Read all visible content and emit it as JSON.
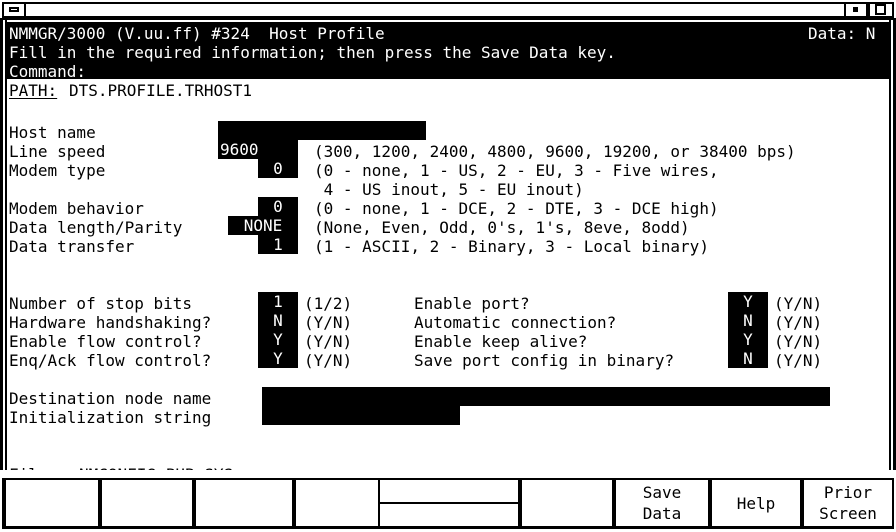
{
  "window": {
    "title": "",
    "left_button_icon": "minimize-icon",
    "min_button_icon": "restore-icon",
    "max_button_icon": "maximize-icon"
  },
  "header": {
    "app_title": "NMMGR/3000 (V.uu.ff) #324  Host Profile",
    "data_status_label": "Data: N",
    "instruction": "Fill in the required information; then press the Save Data key.",
    "command_label": "Command:",
    "command_value": ""
  },
  "path": {
    "label": "PATH:",
    "value": "DTS.PROFILE.TRHOST1"
  },
  "form": {
    "rows": [
      {
        "label": "Host name",
        "value": "",
        "field_chars": 20,
        "help": ""
      },
      {
        "label": "Line speed",
        "value": "9600",
        "field_chars": 6,
        "help": "(300, 1200, 2400, 4800, 9600, 19200, or 38400 bps)"
      },
      {
        "label": "Modem type",
        "value": "0",
        "field_chars": 1,
        "help": "(0 - none, 1 - US, 2 - EU, 3 - Five wires,"
      },
      {
        "label": "",
        "value": null,
        "field_chars": 0,
        "help": " 4 - US inout, 5 - EU inout)"
      },
      {
        "label": "Modem behavior",
        "value": "0",
        "field_chars": 1,
        "help": "(0 - none, 1 - DCE, 2 - DTE, 3 - DCE high)"
      },
      {
        "label": "Data length/Parity",
        "value": "NONE",
        "field_chars": 4,
        "help": "(None, Even, Odd, 0's, 1's, 8eve, 8odd)"
      },
      {
        "label": "Data transfer",
        "value": "1",
        "field_chars": 1,
        "help": "(1 - ASCII, 2 - Binary, 3 - Local binary)"
      }
    ],
    "toggles_left": [
      {
        "label": "Number of stop bits",
        "value": "1",
        "hint": "(1/2)"
      },
      {
        "label": "Hardware handshaking?",
        "value": "N",
        "hint": "(Y/N)"
      },
      {
        "label": "Enable flow control?",
        "value": "Y",
        "hint": "(Y/N)"
      },
      {
        "label": "Enq/Ack flow control?",
        "value": "Y",
        "hint": "(Y/N)"
      }
    ],
    "toggles_right": [
      {
        "label": "Enable port?",
        "value": "Y",
        "hint": "(Y/N)"
      },
      {
        "label": "Automatic connection?",
        "value": "N",
        "hint": "(Y/N)"
      },
      {
        "label": "Enable keep alive?",
        "value": "Y",
        "hint": "(Y/N)"
      },
      {
        "label": "Save port config in binary?",
        "value": "N",
        "hint": "(Y/N)"
      }
    ],
    "text_fields": [
      {
        "label": "Destination node name",
        "value": "",
        "field_chars": 50
      },
      {
        "label": "Initialization string",
        "value": "",
        "field_chars": 19
      }
    ]
  },
  "file": {
    "label": "File:",
    "value": "NMCONFIG.PUB.SYS"
  },
  "function_keys": [
    {
      "line1": "",
      "line2": ""
    },
    {
      "line1": "",
      "line2": ""
    },
    {
      "line1": "",
      "line2": ""
    },
    {
      "line1": "",
      "line2": ""
    },
    {
      "line1": "",
      "line2": ""
    },
    {
      "line1": "",
      "line2": ""
    },
    {
      "line1": "Save",
      "line2": "Data"
    },
    {
      "line1": "Help",
      "line2": ""
    },
    {
      "line1": "Prior",
      "line2": "Screen"
    }
  ],
  "colors": {
    "background": "#ffffff",
    "foreground": "#000000",
    "field_background": "#000000",
    "field_foreground": "#ffffff"
  }
}
